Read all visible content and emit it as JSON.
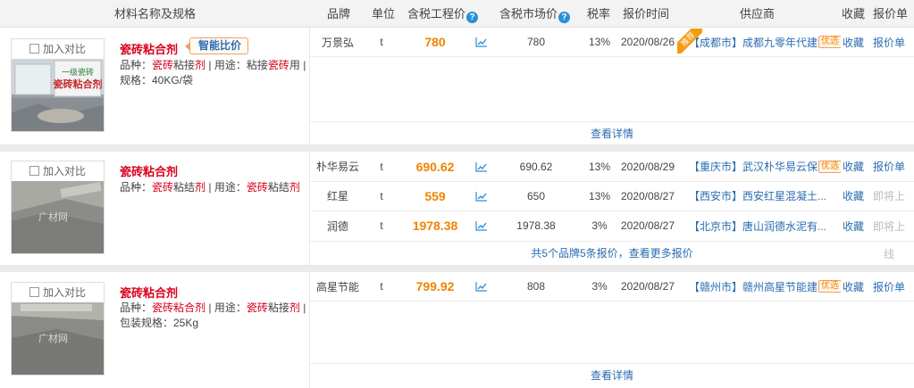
{
  "header": {
    "name": "材料名称及规格",
    "brand": "品牌",
    "unit": "单位",
    "eng_price": "含税工程价",
    "mkt_price": "含税市场价",
    "tax": "税率",
    "time": "报价时间",
    "supplier": "供应商",
    "fav": "收藏",
    "quote": "报价单"
  },
  "products": [
    {
      "compare_label": "加入对比",
      "name": "瓷砖粘合剂",
      "smart_label": "智能比价",
      "image_text": "瓷砖粘合剂",
      "desc": {
        "k1": "品种：",
        "v1a": "瓷砖",
        "v1b": "粘接",
        "v1c": "剂",
        "k2": " | 用途：粘接",
        "v2": "瓷砖",
        "k3": "用 |",
        "k4": "规格：40KG/袋"
      },
      "rows": [
        {
          "brand": "万景弘",
          "unit": "t",
          "eng_price": "780",
          "mkt_price": "780",
          "tax": "13%",
          "time": "2020/08/26",
          "ribbon": "推荐",
          "city": "【成都市】",
          "supplier": "成都九零年代建",
          "tag": "优选",
          "fav": "收藏",
          "quote": "报价单"
        }
      ],
      "footer": "查看详情"
    },
    {
      "compare_label": "加入对比",
      "name": "瓷砖粘合剂",
      "watermark": "广材网",
      "desc": {
        "k1": "品种：",
        "v1a": "瓷砖",
        "v1b": "粘结",
        "v1c": "剂",
        "k2": " | 用途：",
        "v2a": "瓷砖",
        "v2b": "粘结",
        "v2c": "剂"
      },
      "rows": [
        {
          "brand": "朴华易云",
          "unit": "t",
          "eng_price": "690.62",
          "mkt_price": "690.62",
          "tax": "13%",
          "time": "2020/08/29",
          "city": "【重庆市】",
          "supplier": "武汉朴华易云保",
          "tag": "优选",
          "fav": "收藏",
          "quote": "报价单"
        },
        {
          "brand": "红星",
          "unit": "t",
          "eng_price": "559",
          "mkt_price": "650",
          "tax": "13%",
          "time": "2020/08/27",
          "city": "【西安市】",
          "supplier": "西安红星混凝土...",
          "fav": "收藏",
          "quote": "即将上"
        },
        {
          "brand": "润德",
          "unit": "t",
          "eng_price": "1978.38",
          "mkt_price": "1978.38",
          "tax": "3%",
          "time": "2020/08/27",
          "city": "【北京市】",
          "supplier": "唐山润德水泥有...",
          "fav": "收藏",
          "quote": "即将上"
        }
      ],
      "footer": "共5个品牌5条报价，查看更多报价",
      "footer_side": "线"
    },
    {
      "compare_label": "加入对比",
      "name": "瓷砖粘合剂",
      "watermark": "广材网",
      "desc": {
        "k1": "品种：",
        "v1a": "瓷砖",
        "v1b": "粘合",
        "v1c": "剂",
        "k2": " | 用途：",
        "v2a": "瓷砖",
        "v2b": "粘接",
        "v2c": "剂",
        "k3": " |",
        "k4": "包装规格：25Kg"
      },
      "rows": [
        {
          "brand": "高星节能",
          "unit": "t",
          "eng_price": "799.92",
          "mkt_price": "808",
          "tax": "3%",
          "time": "2020/08/27",
          "city": "【赣州市】",
          "supplier": "赣州高星节能建",
          "tag": "优选",
          "fav": "收藏",
          "quote": "报价单"
        }
      ],
      "footer": "查看详情"
    }
  ]
}
